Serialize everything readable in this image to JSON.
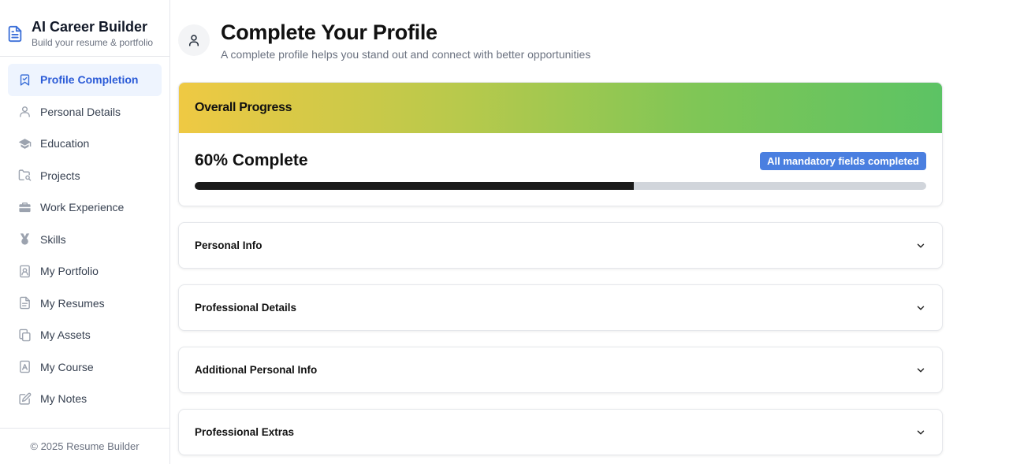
{
  "brand": {
    "title": "AI Career Builder",
    "subtitle": "Build your resume & portfolio",
    "icon": "document-icon"
  },
  "sidebar": {
    "items": [
      {
        "label": "Profile Completion",
        "icon": "bookmark-check-icon",
        "active": true
      },
      {
        "label": "Personal Details",
        "icon": "user-icon",
        "active": false
      },
      {
        "label": "Education",
        "icon": "graduation-cap-icon",
        "active": false
      },
      {
        "label": "Projects",
        "icon": "folder-search-icon",
        "active": false
      },
      {
        "label": "Work Experience",
        "icon": "briefcase-icon",
        "active": false
      },
      {
        "label": "Skills",
        "icon": "medal-icon",
        "active": false
      },
      {
        "label": "My Portfolio",
        "icon": "portfolio-icon",
        "active": false
      },
      {
        "label": "My Resumes",
        "icon": "file-text-icon",
        "active": false
      },
      {
        "label": "My Assets",
        "icon": "copy-icon",
        "active": false
      },
      {
        "label": "My Course",
        "icon": "book-icon",
        "active": false
      },
      {
        "label": "My Notes",
        "icon": "edit-note-icon",
        "active": false
      }
    ],
    "footer": "© 2025 Resume Builder"
  },
  "header": {
    "title": "Complete Your Profile",
    "subtitle": "A complete profile helps you stand out and connect with better opportunities",
    "icon": "user-icon"
  },
  "progress": {
    "banner_title": "Overall Progress",
    "percent_text": "60% Complete",
    "badge": "All mandatory fields completed",
    "fill_fraction": 0.6
  },
  "sections": [
    {
      "label": "Personal Info"
    },
    {
      "label": "Professional Details"
    },
    {
      "label": "Additional Personal Info"
    },
    {
      "label": "Professional Extras"
    }
  ],
  "colors": {
    "accent": "#3b6fd8",
    "active_bg": "#eef4fe",
    "badge": "#4a7fe0",
    "progress_fill": "#1a1a1a",
    "progress_track": "#d1d5db",
    "banner_start": "#efc943",
    "banner_end": "#5cc364"
  }
}
